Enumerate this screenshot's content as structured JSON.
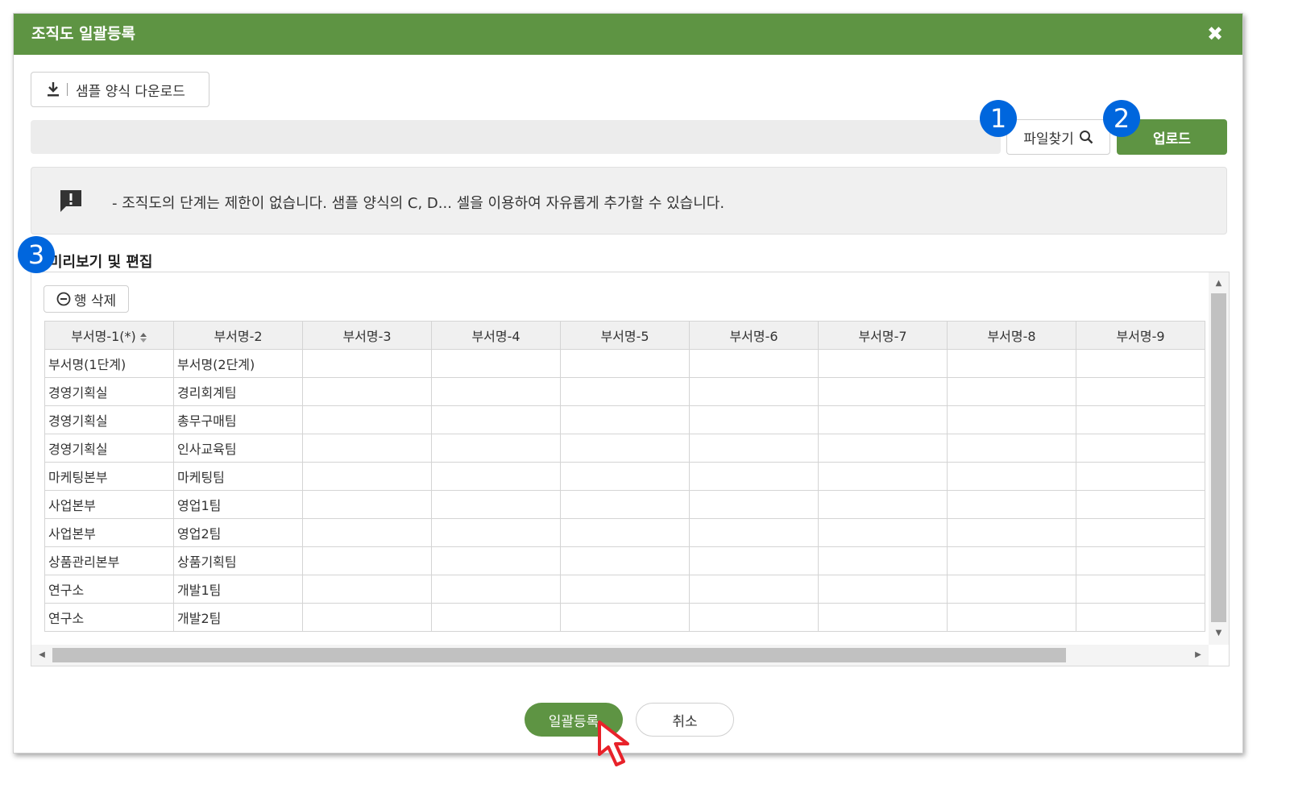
{
  "dialog": {
    "title": "조직도 일괄등록",
    "close_icon": "close-icon"
  },
  "sample_download": {
    "label": "샘플 양식 다운로드",
    "icon": "download-icon"
  },
  "file": {
    "path_value": "",
    "find_label": "파일찾기",
    "find_icon": "search-icon",
    "upload_label": "업로드"
  },
  "notice": {
    "icon": "alert-message-icon",
    "text": "- 조직도의 단계는 제한이 없습니다. 샘플 양식의 C, D... 셀을 이용하여 자유롭게 추가할 수 있습니다."
  },
  "preview": {
    "title": "미리보기 및 편집",
    "delete_row_label": "행 삭제",
    "delete_row_icon": "minus-circle-icon",
    "columns": [
      "부서명-1(*)",
      "부서명-2",
      "부서명-3",
      "부서명-4",
      "부서명-5",
      "부서명-6",
      "부서명-7",
      "부서명-8",
      "부서명-9"
    ],
    "rows": [
      [
        "부서명(1단계)",
        "부서명(2단계)",
        "",
        "",
        "",
        "",
        "",
        "",
        ""
      ],
      [
        "경영기획실",
        "경리회계팀",
        "",
        "",
        "",
        "",
        "",
        "",
        ""
      ],
      [
        "경영기획실",
        "총무구매팀",
        "",
        "",
        "",
        "",
        "",
        "",
        ""
      ],
      [
        "경영기획실",
        "인사교육팀",
        "",
        "",
        "",
        "",
        "",
        "",
        ""
      ],
      [
        "마케팅본부",
        "마케팅팀",
        "",
        "",
        "",
        "",
        "",
        "",
        ""
      ],
      [
        "사업본부",
        "영업1팀",
        "",
        "",
        "",
        "",
        "",
        "",
        ""
      ],
      [
        "사업본부",
        "영업2팀",
        "",
        "",
        "",
        "",
        "",
        "",
        ""
      ],
      [
        "상품관리본부",
        "상품기획팀",
        "",
        "",
        "",
        "",
        "",
        "",
        ""
      ],
      [
        "연구소",
        "개발1팀",
        "",
        "",
        "",
        "",
        "",
        "",
        ""
      ],
      [
        "연구소",
        "개발2팀",
        "",
        "",
        "",
        "",
        "",
        "",
        ""
      ]
    ]
  },
  "footer": {
    "bulk_register_label": "일괄등록",
    "cancel_label": "취소"
  },
  "markers": [
    "1",
    "2",
    "3"
  ],
  "colors": {
    "primary_green": "#5e9443",
    "marker_blue": "#0066dd",
    "cursor_red": "#e8222a"
  }
}
